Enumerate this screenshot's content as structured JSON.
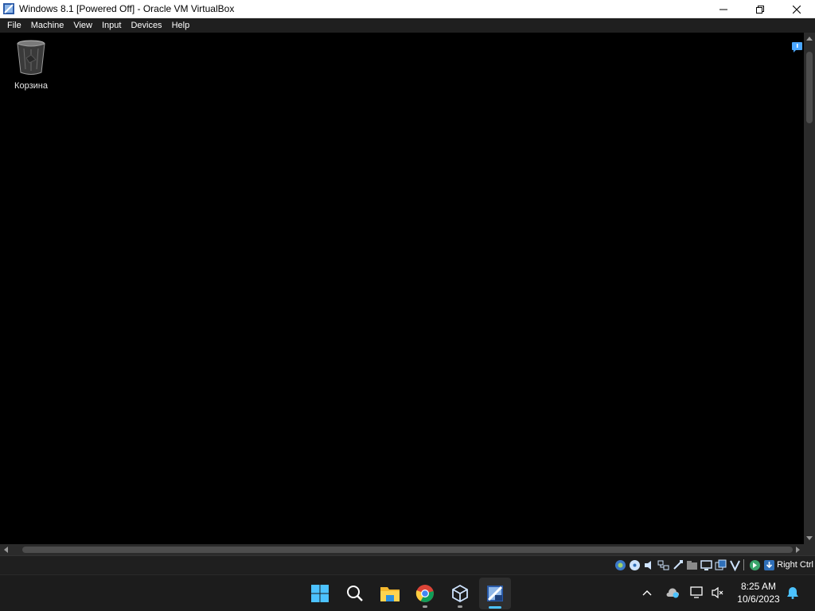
{
  "window": {
    "title": "Windows 8.1 [Powered Off] - Oracle VM VirtualBox"
  },
  "menu": {
    "items": [
      {
        "label": "File"
      },
      {
        "label": "Machine"
      },
      {
        "label": "View"
      },
      {
        "label": "Input"
      },
      {
        "label": "Devices"
      },
      {
        "label": "Help"
      }
    ]
  },
  "desktop": {
    "recycle_bin_label": "Корзина"
  },
  "statusbar": {
    "host_key": "Right Ctrl",
    "indicator_icons": [
      "hard-disk-icon",
      "optical-drive-icon",
      "audio-icon",
      "network-icon",
      "usb-icon",
      "shared-folders-icon",
      "display-icon",
      "recording-icon",
      "virtualization-icon",
      "mouse-integration-icon",
      "keyboard-icon"
    ]
  },
  "taskbar": {
    "apps": [
      "start-icon",
      "search-icon",
      "file-explorer-icon",
      "chrome-icon",
      "virtualbox-manager-icon",
      "virtualbox-vm-icon"
    ],
    "time": "8:25 AM",
    "date": "10/6/2023"
  },
  "colors": {
    "titlebar_bg": "#ffffff",
    "menubar_bg": "#1f1f1f",
    "taskbar_bg": "#1c1c1c",
    "accent": "#4cc2ff"
  }
}
